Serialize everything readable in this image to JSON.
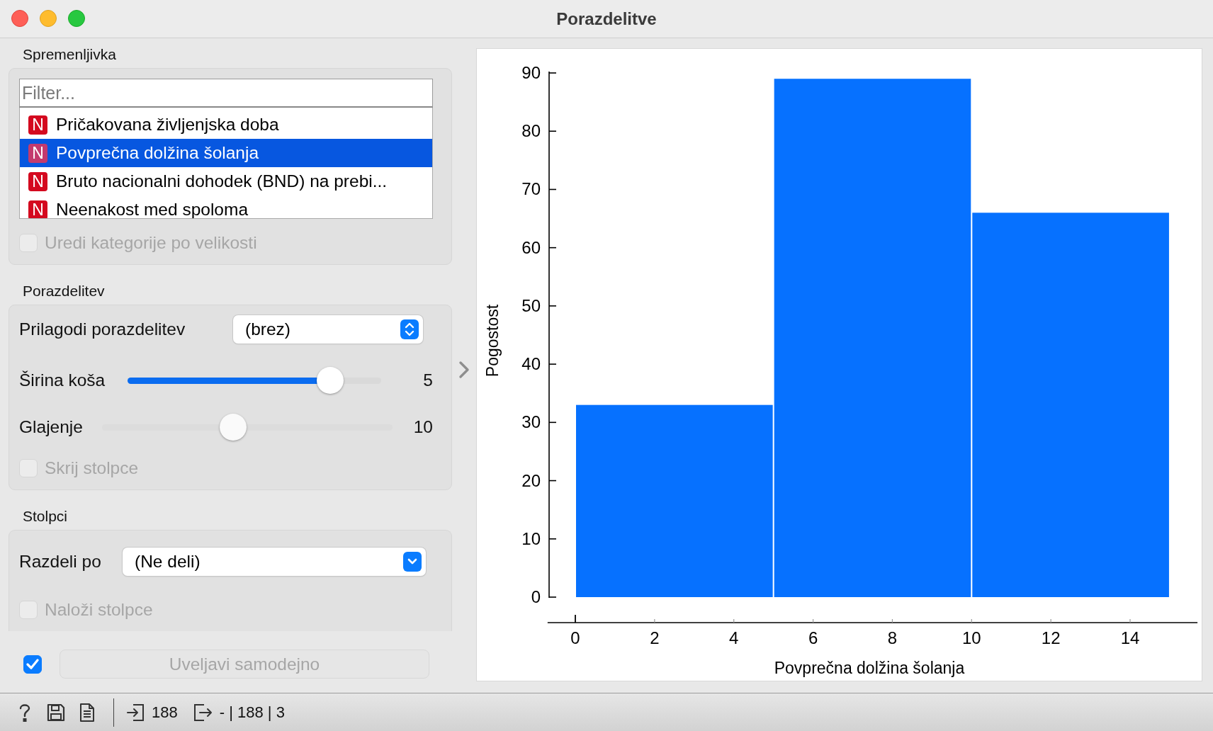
{
  "window": {
    "title": "Porazdelitve"
  },
  "variable_section": {
    "title": "Spremenljivka",
    "filter": {
      "placeholder": "Filter..."
    },
    "items": [
      {
        "badge": "N",
        "label": "Pričakovana življenjska doba",
        "selected": false
      },
      {
        "badge": "N",
        "label": "Povprečna dolžina šolanja",
        "selected": true
      },
      {
        "badge": "N",
        "label": "Bruto nacionalni dohodek (BND) na prebi...",
        "selected": false
      },
      {
        "badge": "N",
        "label": "Neenakost med spoloma",
        "selected": false
      }
    ],
    "sort_checkbox": {
      "label": "Uredi kategorije po velikosti",
      "checked": false,
      "disabled": true
    }
  },
  "distribution_section": {
    "title": "Porazdelitev",
    "fit": {
      "label": "Prilagodi porazdelitev",
      "value": "(brez)",
      "kind": "popup"
    },
    "sliders": [
      {
        "label": "Širina koša",
        "level": 0.8,
        "reading": "5",
        "disabled": false
      },
      {
        "label": "Glajenje",
        "level": 0.45,
        "reading": "10",
        "disabled": true
      }
    ],
    "hide_bars": {
      "label": "Skrij stolpce",
      "checked": false,
      "disabled": true
    }
  },
  "columns_section": {
    "title": "Stolpci",
    "split": {
      "label": "Razdeli po",
      "value": "(Ne deli)",
      "kind": "combo"
    },
    "stack": {
      "label": "Naloži stolpce",
      "checked": false,
      "disabled": true
    }
  },
  "auto_commit": {
    "checked": true,
    "label": "Uveljavi samodejno",
    "disabled": true
  },
  "chart": {
    "chart_data": {
      "type": "bar",
      "xlabel": "Povprečna dolžina šolanja",
      "ylabel": "Pogostost",
      "x": [
        2.5,
        7.5,
        12.5
      ],
      "series": [
        {
          "color": "#0671ff",
          "values": [
            33,
            89,
            66
          ]
        }
      ],
      "xlim": [
        -0.7,
        15.7
      ],
      "ylim": [
        0,
        90
      ],
      "xticks": [
        0,
        2,
        4,
        6,
        8,
        10,
        12,
        14
      ],
      "yticks": [
        0,
        10,
        20,
        30,
        40,
        50,
        60,
        70,
        80,
        90
      ]
    }
  },
  "status_bar": {
    "input_count": "188",
    "output_summary": "- | 188 | 3"
  }
}
